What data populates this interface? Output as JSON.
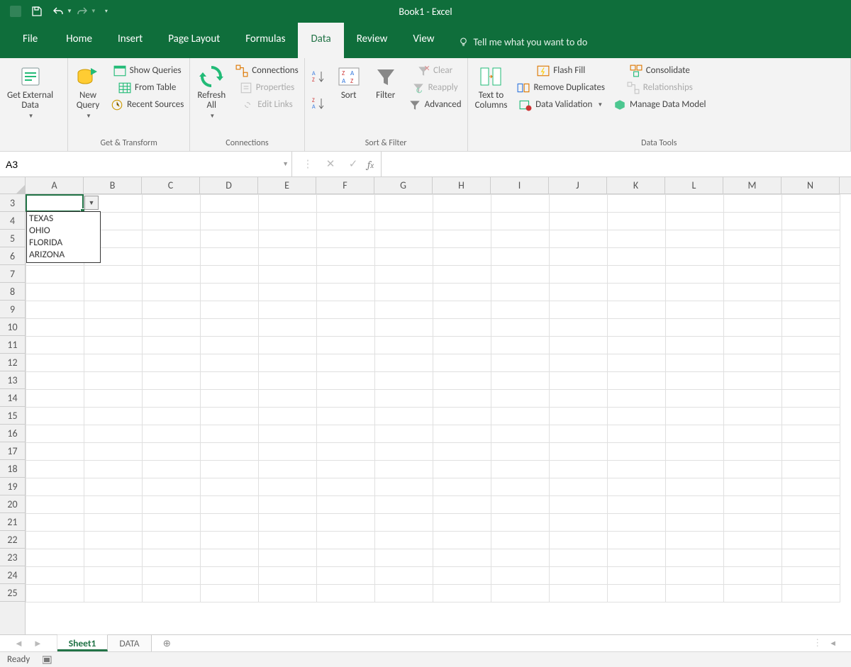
{
  "title": "Book1 - Excel",
  "qat": {
    "save": "Save",
    "undo": "Undo",
    "redo": "Redo"
  },
  "tabs": {
    "file": "File",
    "home": "Home",
    "insert": "Insert",
    "pagelayout": "Page Layout",
    "formulas": "Formulas",
    "data": "Data",
    "review": "Review",
    "view": "View",
    "tellme": "Tell me what you want to do"
  },
  "ribbon": {
    "getexternal": "Get External\nData",
    "newquery": "New\nQuery",
    "showqueries": "Show Queries",
    "fromtable": "From Table",
    "recentsources": "Recent Sources",
    "group_gettransform": "Get & Transform",
    "refreshall": "Refresh\nAll",
    "connections": "Connections",
    "properties": "Properties",
    "editlinks": "Edit Links",
    "group_connections": "Connections",
    "sort": "Sort",
    "filter": "Filter",
    "clear": "Clear",
    "reapply": "Reapply",
    "advanced": "Advanced",
    "group_sortfilter": "Sort & Filter",
    "texttocolumns": "Text to\nColumns",
    "flashfill": "Flash Fill",
    "removedup": "Remove Duplicates",
    "datavalidation": "Data Validation",
    "consolidate": "Consolidate",
    "relationships": "Relationships",
    "managemodel": "Manage Data Model",
    "group_datatools": "Data Tools"
  },
  "namebox": "A3",
  "formula": "",
  "columns": [
    "A",
    "B",
    "C",
    "D",
    "E",
    "F",
    "G",
    "H",
    "I",
    "J",
    "K",
    "L",
    "M",
    "N"
  ],
  "rows": [
    3,
    4,
    5,
    6,
    7,
    8,
    9,
    10,
    11,
    12,
    13,
    14,
    15,
    16,
    17,
    18,
    19,
    20,
    21,
    22,
    23,
    24,
    25
  ],
  "validation_list": [
    "TEXAS",
    "OHIO",
    "FLORIDA",
    "ARIZONA"
  ],
  "sheets": {
    "s1": "Sheet1",
    "s2": "DATA"
  },
  "status": {
    "ready": "Ready"
  }
}
